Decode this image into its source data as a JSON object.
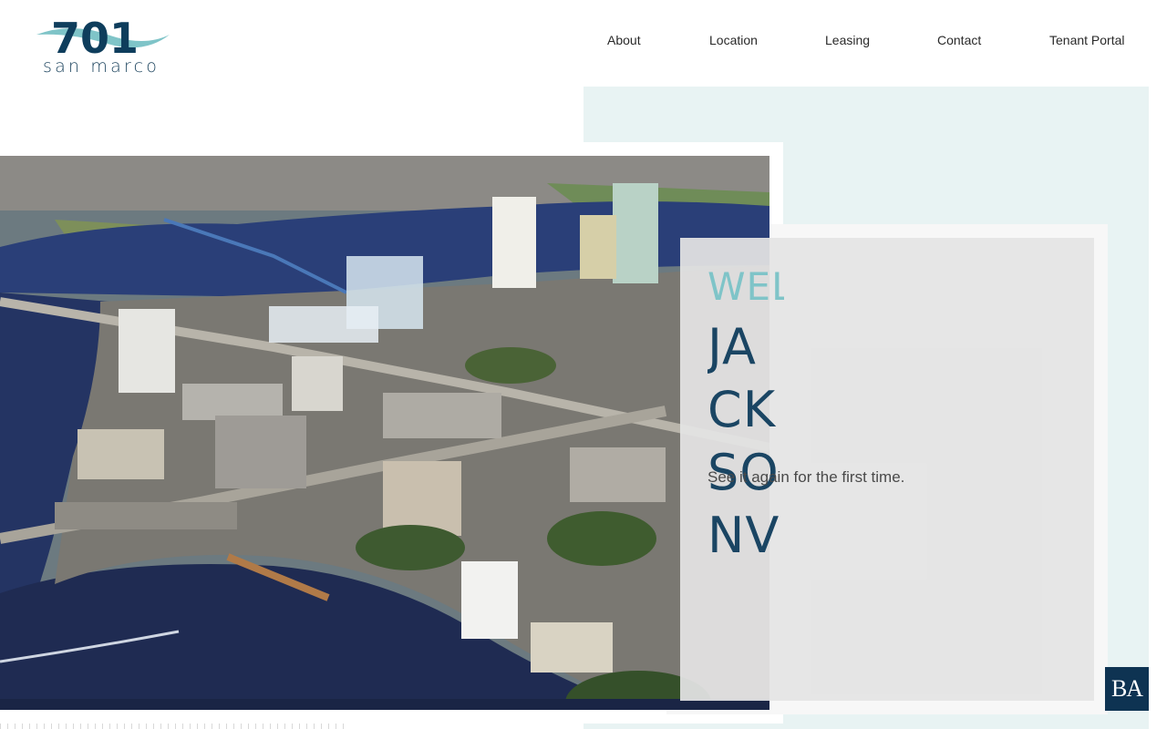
{
  "header": {
    "logo": {
      "number": "701",
      "name": "san marco",
      "icon": "wave-swoosh-icon"
    },
    "nav": [
      {
        "label": "About"
      },
      {
        "label": "Location"
      },
      {
        "label": "Leasing"
      },
      {
        "label": "Contact"
      },
      {
        "label": "Tenant Portal"
      }
    ]
  },
  "hero": {
    "welcome": "WELCOME TO",
    "city": "JACKSONVILLE",
    "tagline": "See it again for the first time.",
    "image": "aerial-downtown-jacksonville-photo"
  },
  "badge": {
    "text": "BA"
  },
  "colors": {
    "navy": "#1a4563",
    "teal": "#7fc4c8",
    "panel": "#e8f3f3",
    "badge": "#0e3352"
  }
}
